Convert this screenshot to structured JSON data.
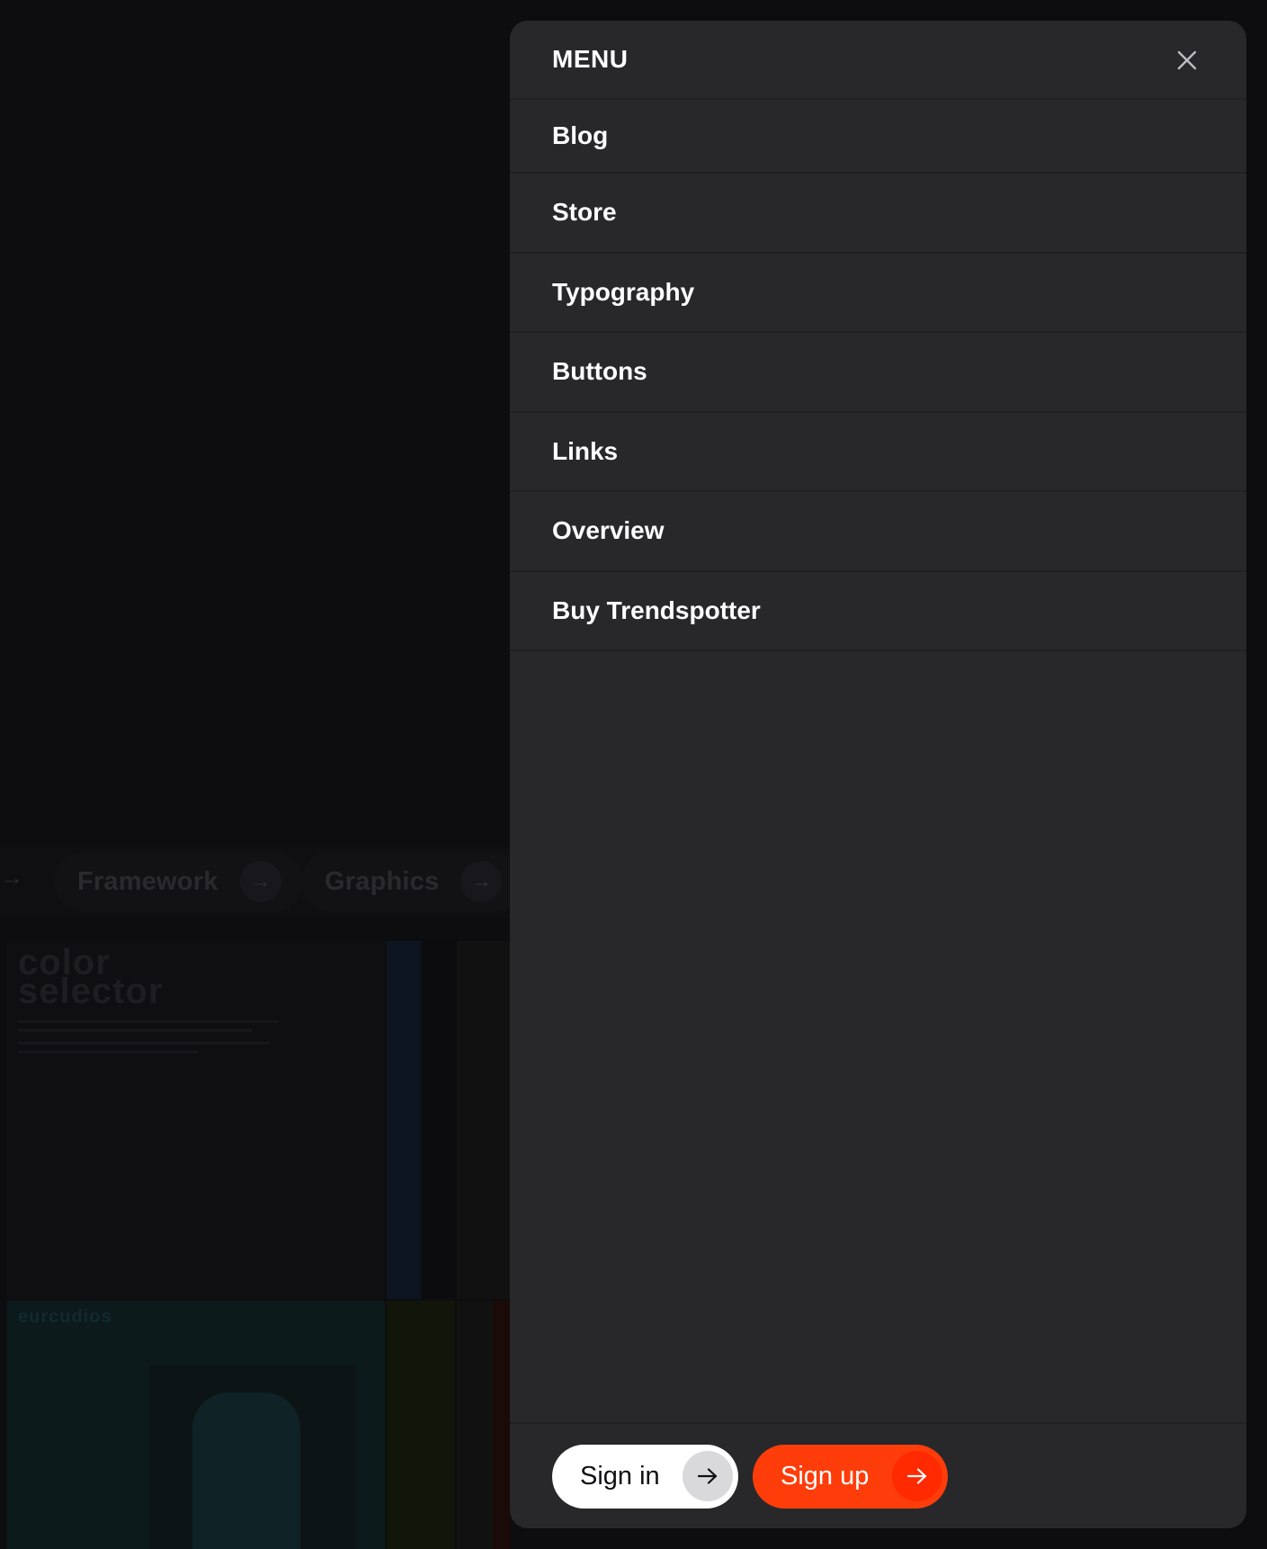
{
  "background": {
    "nav_pills": [
      {
        "label": "Framework"
      },
      {
        "label": "Graphics"
      }
    ],
    "cards": [
      {
        "title": "color selector"
      },
      {
        "title": "eurcudios"
      }
    ]
  },
  "menu": {
    "title": "MENU",
    "close_icon": "close-icon",
    "items": [
      {
        "label": "Blog"
      },
      {
        "label": "Store"
      },
      {
        "label": "Typography"
      },
      {
        "label": "Buttons"
      },
      {
        "label": "Links"
      },
      {
        "label": "Overview"
      },
      {
        "label": "Buy Trendspotter"
      }
    ],
    "footer": {
      "sign_in_label": "Sign in",
      "sign_up_label": "Sign up",
      "arrow_icon": "arrow-right-icon"
    }
  },
  "colors": {
    "panel": "#28282b",
    "accent": "#ff3d0a",
    "text": "#ffffff"
  }
}
